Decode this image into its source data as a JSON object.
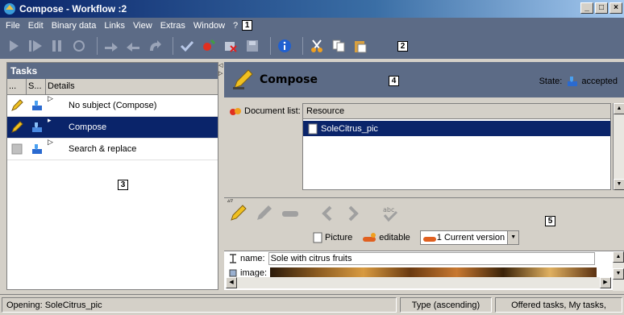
{
  "window": {
    "title": "Compose - Workflow :2",
    "min": "_",
    "max": "□",
    "close": "×"
  },
  "menu": [
    "File",
    "Edit",
    "Binary data",
    "Links",
    "View",
    "Extras",
    "Window",
    "?"
  ],
  "annotations": {
    "a1": "1",
    "a2": "2",
    "a3": "3",
    "a4": "4",
    "a5": "5"
  },
  "tasks": {
    "header": "Tasks",
    "columns": [
      "...",
      "S...",
      "Details"
    ],
    "rows": [
      {
        "details": "No subject (Compose)"
      },
      {
        "details": "Compose"
      },
      {
        "details": "Search & replace"
      }
    ]
  },
  "compose": {
    "title": "Compose",
    "state_label": "State:",
    "state_value": "accepted",
    "doclist_label": "Document list:",
    "resource_header": "Resource",
    "resource_item": "SoleCitrus_pic",
    "picture_label": "Picture",
    "editable_label": "editable",
    "version_label": "1 Current version",
    "name_label": "name:",
    "name_value": "Sole with citrus fruits",
    "image_label": "image:"
  },
  "status": {
    "message": "Opening: SoleCitrus_pic",
    "sort": "Type (ascending)",
    "filter": "Offered tasks, My tasks,"
  },
  "colors": {
    "bar": "#5c6b86",
    "selection": "#0a246a",
    "chrome": "#d4d0c8"
  }
}
